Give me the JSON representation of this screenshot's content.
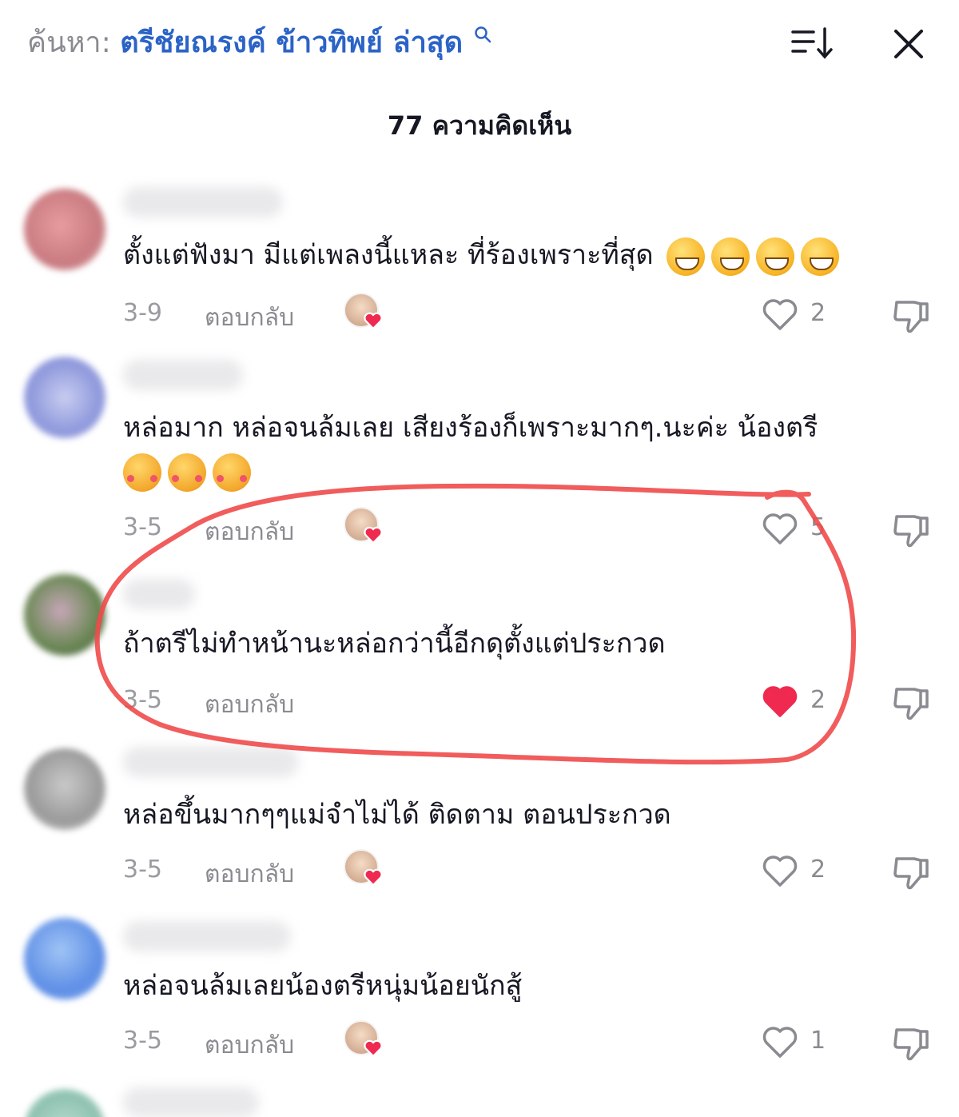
{
  "header": {
    "search_prefix": "ค้นหา:",
    "search_query": "ตรีชัยณรงค์ ข้าวทิพย์ ล่าสุด",
    "search_icon": "search-icon",
    "sort_icon": "sort-icon",
    "close_icon": "close-icon"
  },
  "comment_count": "77 ความคิดเห็น",
  "labels": {
    "reply": "ตอบกลับ"
  },
  "colors": {
    "liked_heart": "#ef2950",
    "search_query": "#2b63c6",
    "annotation": "#f04a4a"
  },
  "comments": [
    {
      "text": "ตั้งแต่ฟังมา มีแต่เพลงนี้แหละ ที่ร้องเพราะที่สุด",
      "emojis": [
        "grinning-face",
        "grinning-face",
        "grinning-face",
        "grinning-face"
      ],
      "date": "3-9",
      "likes": "2",
      "liked": false,
      "creator_liked": true
    },
    {
      "text": "หล่อมาก หล่อจนล้มเลย เสียงร้องก็เพราะมากๆ.นะค่ะ น้องตรี",
      "emojis": [
        "smiling-face-with-hearts",
        "smiling-face-with-hearts",
        "smiling-face-with-hearts"
      ],
      "date": "3-5",
      "likes": "5",
      "liked": false,
      "creator_liked": true
    },
    {
      "text": "ถ้าตรีไม่ทำหน้านะหล่อกว่านี้อีกดุตั้งแต่ประกวด",
      "date": "3-5",
      "likes": "2",
      "liked": true,
      "creator_liked": false,
      "highlighted": true
    },
    {
      "text": "หล่อขึ้นมากๆๆแม่จำไม่ได้ ติดตาม ตอนประกวด",
      "date": "3-5",
      "likes": "2",
      "liked": false,
      "creator_liked": true
    },
    {
      "text": "หล่อจนล้มเลยน้องตรีหนุ่มน้อยนักสู้",
      "date": "3-5",
      "likes": "1",
      "liked": false,
      "creator_liked": true
    }
  ]
}
